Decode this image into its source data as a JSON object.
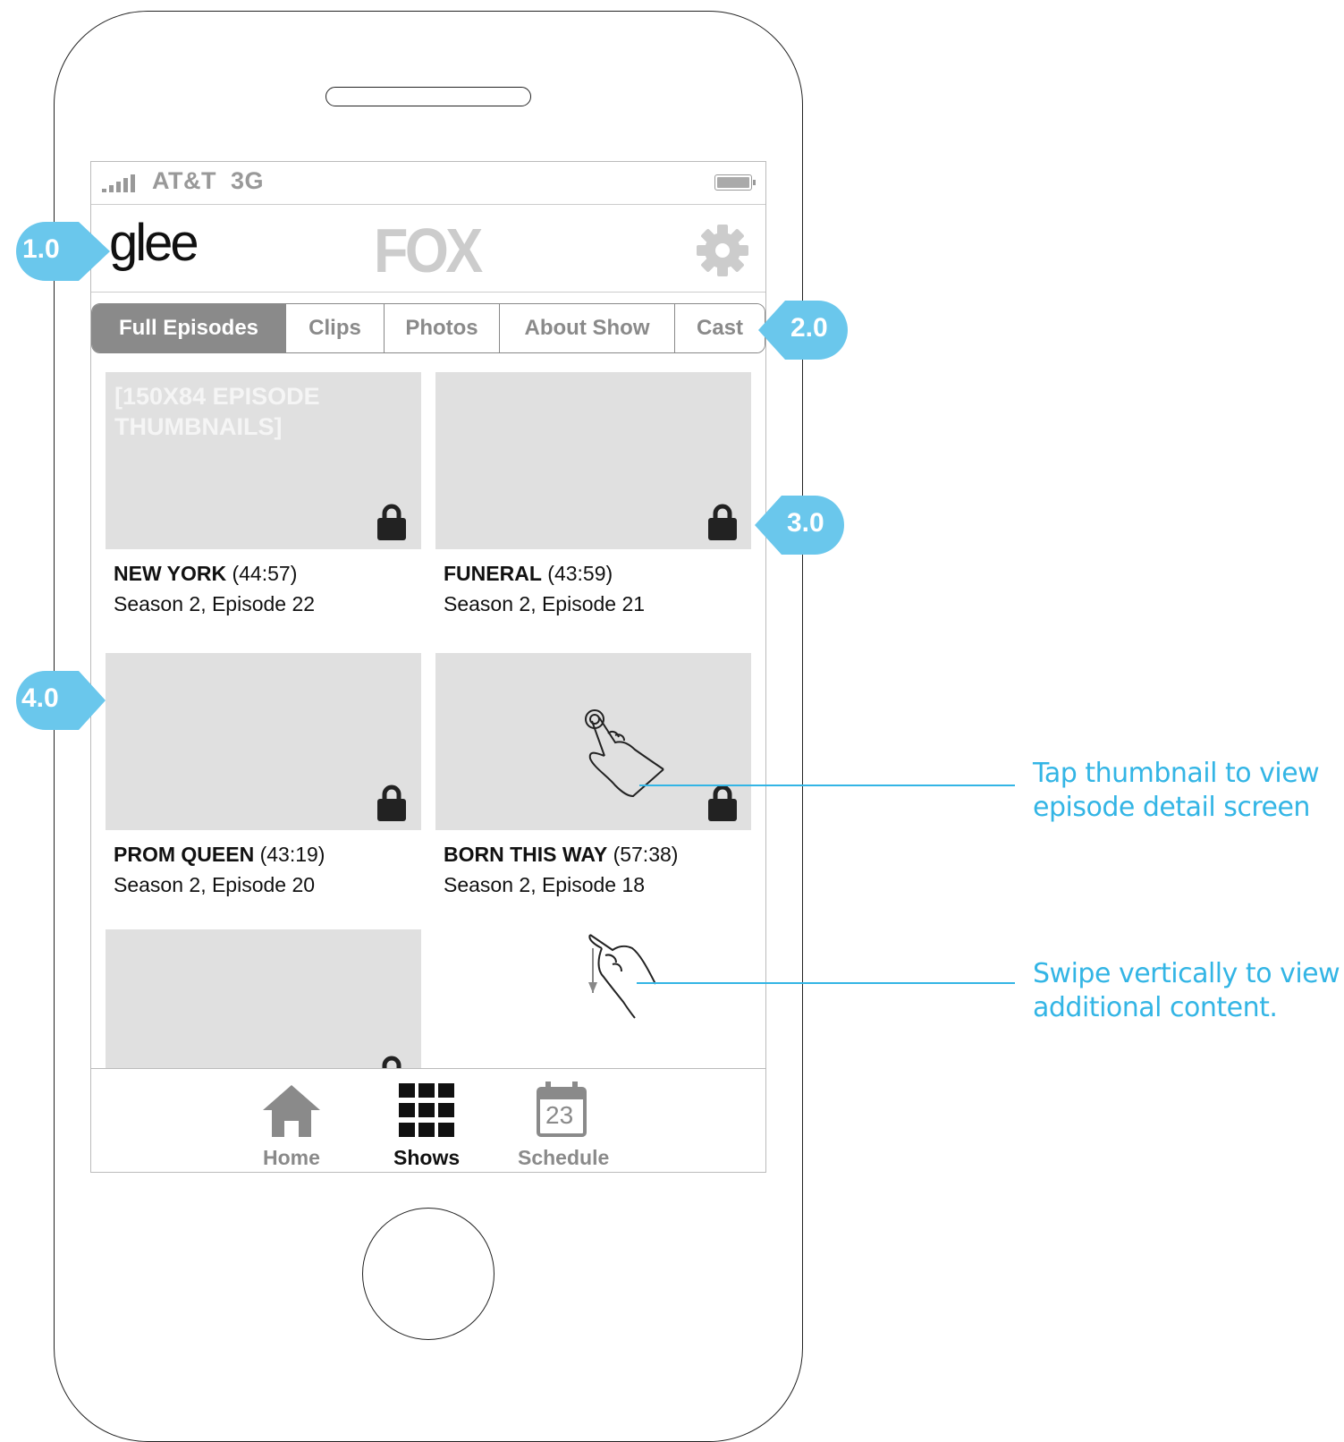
{
  "status_bar": {
    "carrier": "AT&T",
    "network": "3G"
  },
  "header": {
    "app_logo": "glee",
    "network_logo": "FOX"
  },
  "tabs": [
    {
      "label": "Full Episodes",
      "active": true
    },
    {
      "label": "Clips",
      "active": false
    },
    {
      "label": "Photos",
      "active": false
    },
    {
      "label": "About Show",
      "active": false
    },
    {
      "label": "Cast",
      "active": false
    }
  ],
  "thumbnail_placeholder": "[150X84 EPISODE THUMBNAILS]",
  "episodes": [
    {
      "title": "NEW YORK",
      "duration": "(44:57)",
      "subtitle": "Season 2, Episode 22",
      "locked": true
    },
    {
      "title": "FUNERAL",
      "duration": "(43:59)",
      "subtitle": "Season 2, Episode 21",
      "locked": true
    },
    {
      "title": "PROM QUEEN",
      "duration": "(43:19)",
      "subtitle": "Season 2, Episode 20",
      "locked": true
    },
    {
      "title": "BORN THIS WAY",
      "duration": "(57:38)",
      "subtitle": "Season 2, Episode 18",
      "locked": true
    },
    {
      "title": "",
      "duration": "",
      "subtitle": "",
      "locked": true
    }
  ],
  "tab_bar": [
    {
      "label": "Home",
      "icon": "home-icon",
      "active": false
    },
    {
      "label": "Shows",
      "icon": "grid-icon",
      "active": true
    },
    {
      "label": "Schedule",
      "icon": "calendar-icon",
      "active": false,
      "icon_text": "23"
    }
  ],
  "annotations": {
    "badges": [
      "1.0",
      "2.0",
      "3.0",
      "4.0"
    ],
    "notes": [
      {
        "line1": "Tap thumbnail to view",
        "line2": "episode detail screen"
      },
      {
        "line1": "Swipe vertically to view",
        "line2": "additional content."
      }
    ]
  },
  "colors": {
    "annotation_blue": "#33b5e5",
    "active_tab": "#8a8a8a",
    "thumbnail_gray": "#e0e0e0"
  }
}
